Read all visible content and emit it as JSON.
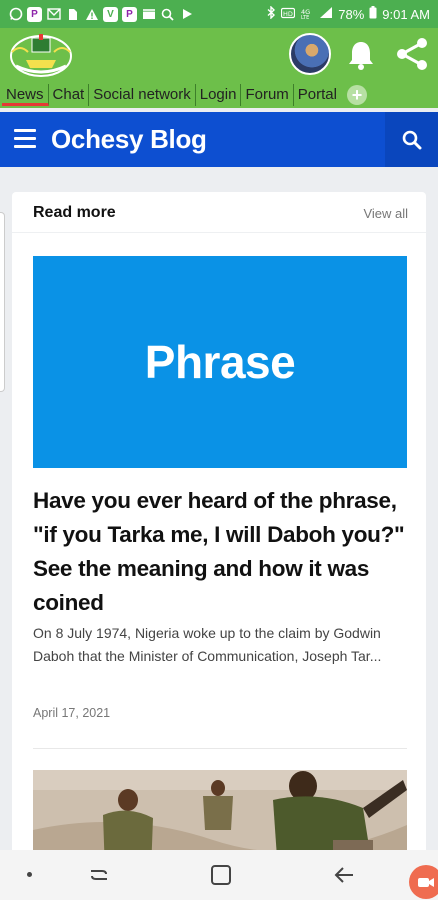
{
  "status_bar": {
    "battery": "78%",
    "time": "9:01 AM",
    "notif_letters": [
      "P",
      "V",
      "P"
    ]
  },
  "app": {
    "tabs": [
      {
        "label": "News",
        "active": true
      },
      {
        "label": "Chat"
      },
      {
        "label": "Social network"
      },
      {
        "label": "Login"
      },
      {
        "label": "Forum"
      },
      {
        "label": "Portal"
      }
    ],
    "add_tab_symbol": "+",
    "colors": {
      "appbar": "#6dbf4a",
      "statusbar": "#4caf50",
      "active_tab": "#e53935"
    }
  },
  "blog": {
    "title": "Ochesy Blog",
    "color": "#0d4fd1"
  },
  "section": {
    "title": "Read more",
    "view_all": "View all"
  },
  "article": {
    "image_text": "Phrase",
    "image_color": "#0a92e6",
    "headline": "Have you ever heard of the phrase, \"if you Tarka me, I will Daboh you?\" See the meaning and how it was coined",
    "excerpt": "On 8 July 1974, Nigeria woke up to the claim by Godwin Daboh that the Minister of Communication, Joseph Tar...",
    "date": "April 17, 2021"
  },
  "icons": {
    "status_left": [
      "whatsapp-icon",
      "p-app-icon",
      "mail-icon",
      "sim-icon",
      "warning-icon",
      "vpn-icon",
      "p-app-icon",
      "clapper-icon",
      "search-icon",
      "play-icon"
    ],
    "status_right": [
      "bluetooth-icon",
      "hd-icon",
      "4g-icon",
      "signal-icon",
      "battery-icon"
    ],
    "header": [
      "logo-icon",
      "avatar",
      "bell-icon",
      "share-icon"
    ],
    "nav": [
      "nav-dot",
      "recent-apps-icon",
      "home-icon",
      "back-icon",
      "screen-record-icon"
    ]
  }
}
